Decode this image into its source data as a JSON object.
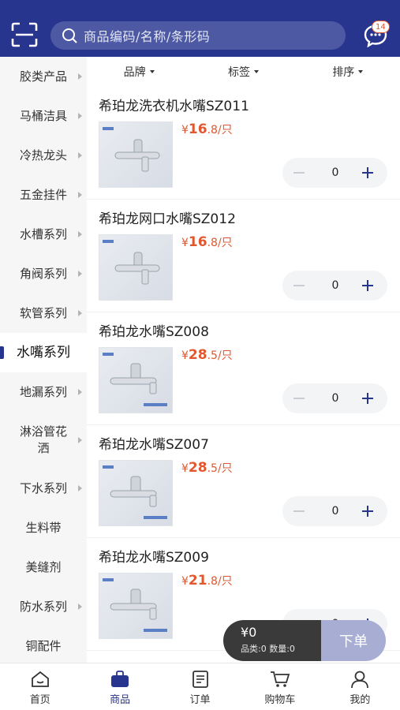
{
  "header": {
    "search_placeholder": "商品编码/名称/条形码",
    "message_badge": "14"
  },
  "sidebar": {
    "items": [
      {
        "label": "胶类产品",
        "arrow": true
      },
      {
        "label": "马桶洁具",
        "arrow": true
      },
      {
        "label": "冷热龙头",
        "arrow": true
      },
      {
        "label": "五金挂件",
        "arrow": true
      },
      {
        "label": "水槽系列",
        "arrow": true
      },
      {
        "label": "角阀系列",
        "arrow": true
      },
      {
        "label": "软管系列",
        "arrow": true
      },
      {
        "label": "水嘴系列",
        "arrow": false,
        "active": true
      },
      {
        "label": "地漏系列",
        "arrow": true
      },
      {
        "label": "淋浴管花洒",
        "arrow": true
      },
      {
        "label": "下水系列",
        "arrow": true
      },
      {
        "label": "生料带",
        "arrow": false
      },
      {
        "label": "美缝剂",
        "arrow": false
      },
      {
        "label": "防水系列",
        "arrow": true
      },
      {
        "label": "铜配件",
        "arrow": false
      }
    ]
  },
  "filters": {
    "brand": "品牌",
    "tag": "标签",
    "sort": "排序"
  },
  "products": [
    {
      "name": "希珀龙洗衣机水嘴SZ011",
      "currency": "¥",
      "price_int": "16",
      "price_dec": ".8",
      "unit": "/只",
      "qty": "0"
    },
    {
      "name": "希珀龙网口水嘴SZ012",
      "currency": "¥",
      "price_int": "16",
      "price_dec": ".8",
      "unit": "/只",
      "qty": "0"
    },
    {
      "name": "希珀龙水嘴SZ008",
      "currency": "¥",
      "price_int": "28",
      "price_dec": ".5",
      "unit": "/只",
      "qty": "0"
    },
    {
      "name": "希珀龙水嘴SZ007",
      "currency": "¥",
      "price_int": "28",
      "price_dec": ".5",
      "unit": "/只",
      "qty": "0"
    },
    {
      "name": "希珀龙水嘴SZ009",
      "currency": "¥",
      "price_int": "21",
      "price_dec": ".8",
      "unit": "/只",
      "qty": "0"
    }
  ],
  "cart": {
    "total": "¥0",
    "meta": "品类:0 数量:0",
    "order_label": "下单"
  },
  "tabbar": {
    "home": "首页",
    "products": "商品",
    "orders": "订单",
    "cart": "购物车",
    "mine": "我的"
  },
  "colors": {
    "brand": "#27358f",
    "price": "#e1572e"
  }
}
